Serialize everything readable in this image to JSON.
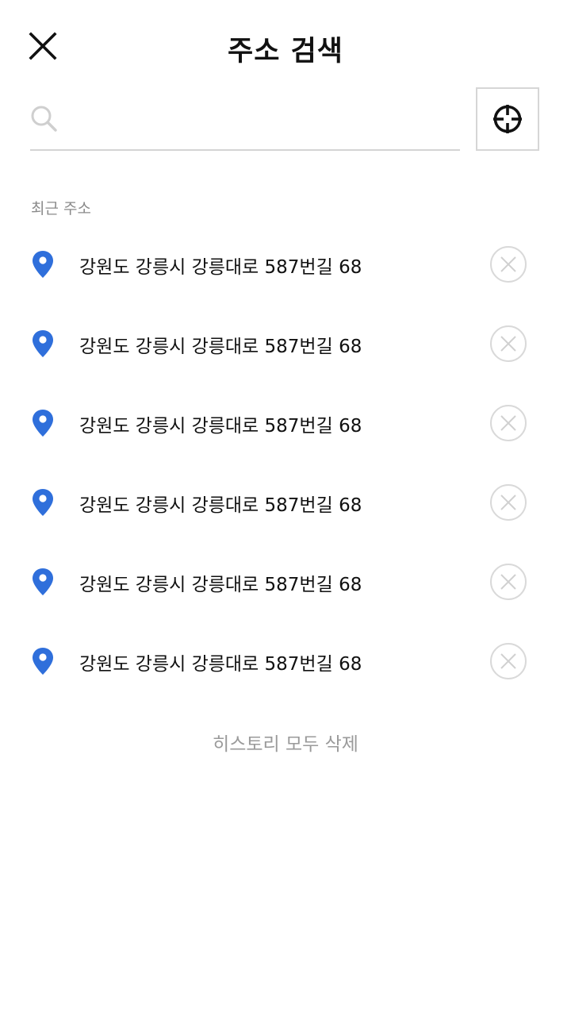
{
  "header": {
    "title": "주소 검색",
    "close_icon": "close-icon"
  },
  "search": {
    "value": "",
    "placeholder": "",
    "search_icon": "search-icon",
    "locate_icon": "crosshair-icon"
  },
  "recent": {
    "label": "최근 주소",
    "items": [
      {
        "address": "강원도 강릉시 강릉대로 587번길 68"
      },
      {
        "address": "강원도 강릉시 강릉대로 587번길 68"
      },
      {
        "address": "강원도 강릉시 강릉대로 587번길 68"
      },
      {
        "address": "강원도 강릉시 강릉대로 587번길 68"
      },
      {
        "address": "강원도 강릉시 강릉대로 587번길 68"
      },
      {
        "address": "강원도 강릉시 강릉대로 587번길 68"
      }
    ],
    "clear_all_label": "히스토리 모두 삭제"
  },
  "colors": {
    "pin": "#2f6fdb",
    "divider": "#d4d4d4",
    "muted_text": "#8a8a8a"
  }
}
